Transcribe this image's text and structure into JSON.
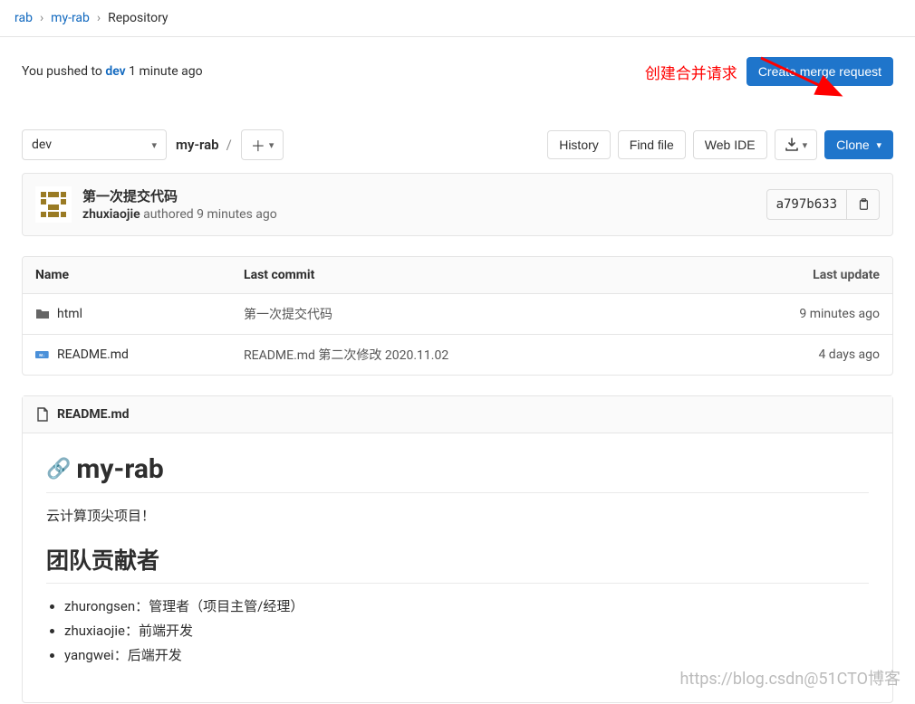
{
  "breadcrumbs": {
    "a": "rab",
    "b": "my-rab",
    "c": "Repository"
  },
  "push": {
    "prefix": "You pushed to ",
    "branch": "dev",
    "suffix": " 1 minute ago",
    "annotation": "创建合并请求",
    "create_request_btn": "Create merge request"
  },
  "actions": {
    "branch": "dev",
    "project": "my-rab",
    "slash": "/",
    "plus": "＋",
    "history": "History",
    "find_file": "Find file",
    "web_ide": "Web IDE",
    "clone": "Clone"
  },
  "commit": {
    "title": "第一次提交代码",
    "author": "zhuxiaojie",
    "authored": " authored 9 minutes ago",
    "sha": "a797b633"
  },
  "tree": {
    "headers": {
      "name": "Name",
      "commit": "Last commit",
      "update": "Last update"
    },
    "rows": [
      {
        "icon": "folder",
        "name": "html",
        "commit": "第一次提交代码",
        "update": "9 minutes ago"
      },
      {
        "icon": "md",
        "name": "README.md",
        "commit": "README.md 第二次修改 2020.11.02",
        "update": "4 days ago"
      }
    ]
  },
  "readme": {
    "filename": "README.md",
    "h1": "my-rab",
    "p1": "云计算顶尖项目！",
    "h2": "团队贡献者",
    "items": [
      "zhurongsen：管理者（项目主管/经理）",
      "zhuxiaojie：前端开发",
      "yangwei：后端开发"
    ]
  },
  "watermark": {
    "line1": "https://blog.csdn@51CTO博客"
  }
}
